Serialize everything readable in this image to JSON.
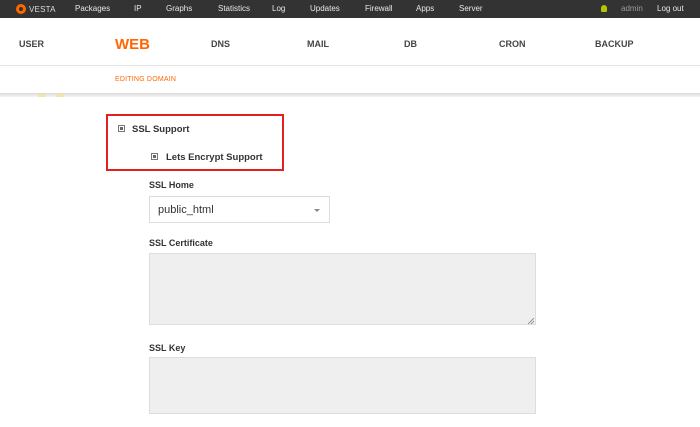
{
  "topbar": {
    "logo_text": "VESTA",
    "nav": [
      "Packages",
      "IP",
      "Graphs",
      "Statistics",
      "Log",
      "Updates",
      "Firewall",
      "Apps",
      "Server"
    ],
    "user": "admin",
    "logout": "Log out"
  },
  "mainmenu": {
    "items": [
      "USER",
      "WEB",
      "DNS",
      "MAIL",
      "DB",
      "CRON",
      "BACKUP"
    ],
    "active": "WEB"
  },
  "subtitle": "EDITING DOMAIN",
  "form": {
    "ssl_support": {
      "label": "SSL Support",
      "checked": true
    },
    "lets_encrypt": {
      "label": "Lets Encrypt Support",
      "checked": true
    },
    "ssl_home": {
      "label": "SSL Home",
      "value": "public_html"
    },
    "ssl_certificate": {
      "label": "SSL Certificate",
      "value": ""
    },
    "ssl_key": {
      "label": "SSL Key",
      "value": ""
    }
  },
  "colors": {
    "accent": "#ff6701",
    "topbar": "#333333",
    "highlight": "#e32020"
  }
}
